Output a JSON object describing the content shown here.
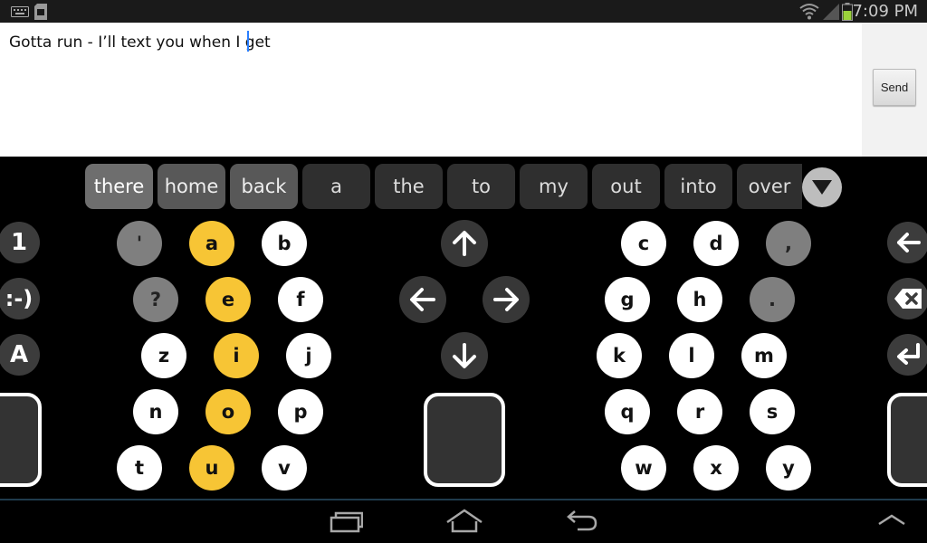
{
  "status_bar": {
    "time": "7:09 PM",
    "left_icons": [
      "keyboard-icon",
      "sd-card-icon"
    ],
    "right_icons": [
      "wifi-icon",
      "signal-icon",
      "battery-icon"
    ]
  },
  "message": {
    "text": "Gotta run - I’ll text you when I get",
    "send_label": "Send"
  },
  "suggestions": [
    "there",
    "home",
    "back",
    "a",
    "the",
    "to",
    "my",
    "out",
    "into",
    "over"
  ],
  "keyboard": {
    "left_side": [
      "1",
      ":-)",
      "A"
    ],
    "left_group": [
      [
        "'",
        "a",
        "b"
      ],
      [
        "?",
        "e",
        "f"
      ],
      [
        "z",
        "i",
        "j"
      ],
      [
        "n",
        "o",
        "p"
      ],
      [
        "t",
        "u",
        "v"
      ]
    ],
    "right_group": [
      [
        "c",
        "d",
        ","
      ],
      [
        "g",
        "h",
        "."
      ],
      [
        "k",
        "l",
        "m"
      ],
      [
        "q",
        "r",
        "s"
      ],
      [
        "w",
        "x",
        "y"
      ]
    ],
    "arrows": [
      "up-arrow-icon",
      "left-arrow-icon",
      "right-arrow-icon",
      "down-arrow-icon"
    ],
    "right_side": [
      "backspace-arrow-icon",
      "delete-icon",
      "enter-icon"
    ],
    "colors": {
      "vowel": "#f7c535",
      "punct": "#7f7f7f",
      "letter": "#ffffff",
      "key_dark": "#373737"
    }
  },
  "nav_bar": {
    "buttons": [
      "recent-apps-icon",
      "home-icon",
      "back-icon",
      "expand-up-icon"
    ]
  }
}
